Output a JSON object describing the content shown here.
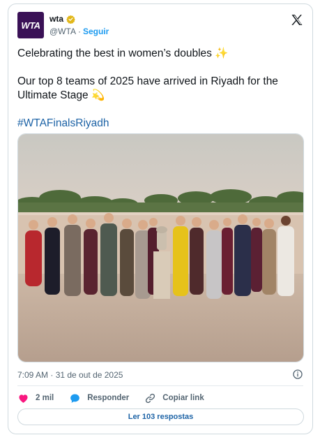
{
  "author": {
    "avatar_text": "WTA",
    "name": "wta",
    "handle": "@WTA",
    "separator": "·",
    "follow_label": "Seguir"
  },
  "tweet": {
    "line1": "Celebrating the best in women’s doubles ✨",
    "line2": "Our top 8 teams of 2025 have arrived in Riyadh for the Ultimate Stage 💫",
    "hashtag": "#WTAFinalsRiyadh"
  },
  "meta": {
    "timestamp": "7:09 AM · 31 de out de 2025"
  },
  "actions": {
    "likes": "2 mil",
    "reply_label": "Responder",
    "copy_link_label": "Copiar link"
  },
  "read_replies_label": "Ler 103 respostas",
  "colors": {
    "avatar_bg": "#3a1156",
    "link": "#1d9bf0",
    "like": "#f91880",
    "reply": "#1d9bf0"
  },
  "icons": [
    "verified-badge-icon",
    "x-logo-icon",
    "info-icon",
    "heart-icon",
    "reply-bubble-icon",
    "link-icon"
  ]
}
